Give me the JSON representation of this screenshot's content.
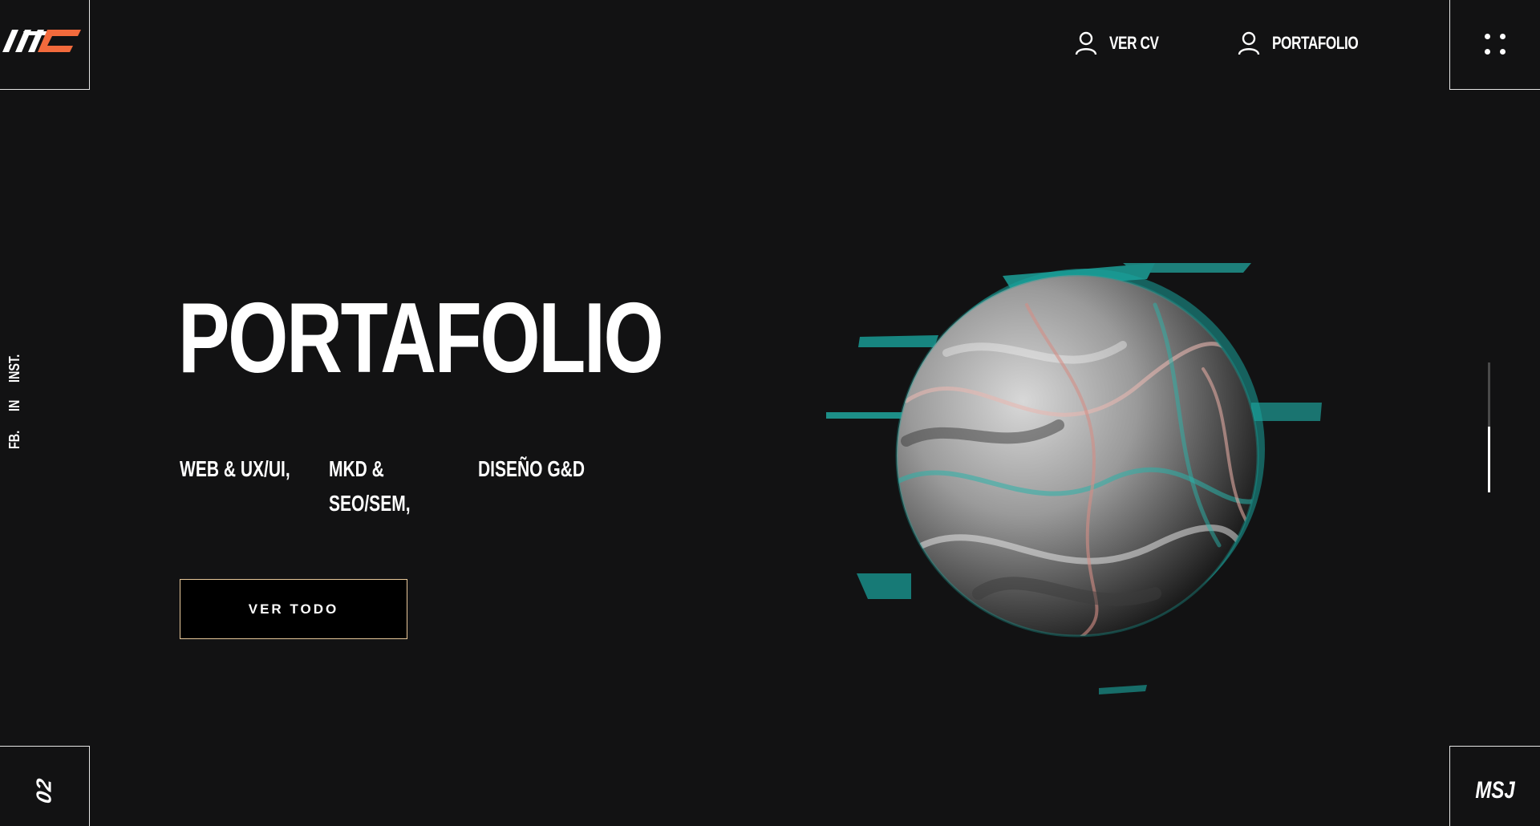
{
  "header": {
    "logo_text": "MC",
    "nav": [
      {
        "label": "VER CV",
        "icon": "user-icon"
      },
      {
        "label": "PORTAFOLIO",
        "icon": "user-icon"
      }
    ],
    "menu_icon": "dots-grid-icon"
  },
  "social": {
    "links": [
      "FB.",
      "IN",
      "INST."
    ]
  },
  "hero": {
    "title": "PORTAFOLIO",
    "services": [
      "WEB & UX/UI,",
      "MKD & SEO/SEM,",
      "DISEÑO G&D"
    ],
    "cta_label": "VER TODO"
  },
  "footer": {
    "page_number": "02",
    "message_label": "MSJ"
  },
  "scroll": {
    "position_fraction": 0.5
  },
  "colors": {
    "background": "#121213",
    "accent_orange": "#f26a3c",
    "cta_border": "#e8c89a",
    "teal": "#1fa6a0"
  }
}
